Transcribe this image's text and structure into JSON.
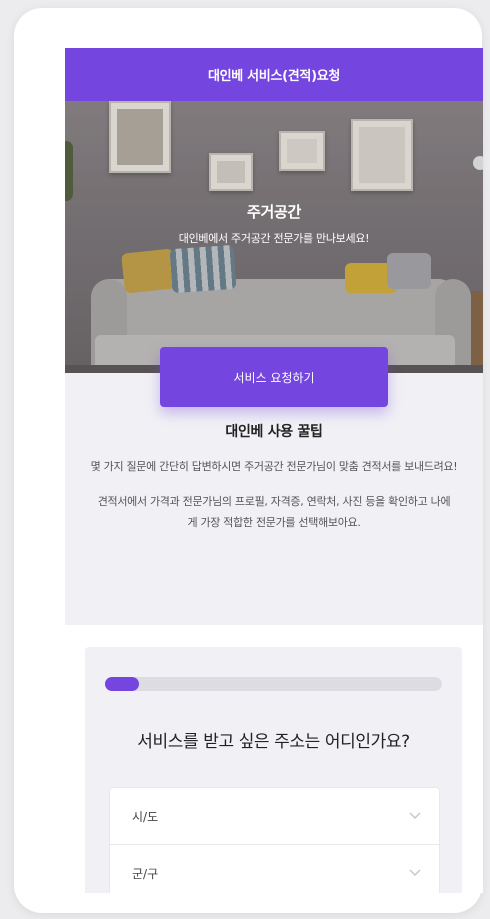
{
  "header": {
    "title": "대인베 서비스(견적)요청"
  },
  "hero": {
    "title": "주거공간",
    "subtitle": "대인베에서 주거공간 전문가를 만나보세요!"
  },
  "cta": {
    "label": "서비스 요청하기"
  },
  "tips": {
    "title": "대인베 사용 꿀팁",
    "paragraph1": "몇 가지 질문에 간단히 답변하시면 주거공간 전문가님이 맞춤 견적서를 보내드려요!",
    "paragraph2": "견적서에서 가격과 전문가님의 프로필, 자격증, 연락처, 사진 등을 확인하고 나에게 가장 적합한 전문가를 선택해보아요."
  },
  "form": {
    "progress": 0.1,
    "question": "서비스를 받고 싶은 주소는 어디인가요?",
    "selects": [
      {
        "label": "시/도",
        "icon": "chevron-down-icon"
      },
      {
        "label": "군/구",
        "icon": "chevron-down-icon"
      }
    ]
  },
  "colors": {
    "brand": "#7446df",
    "background": "#f1f1f5"
  }
}
